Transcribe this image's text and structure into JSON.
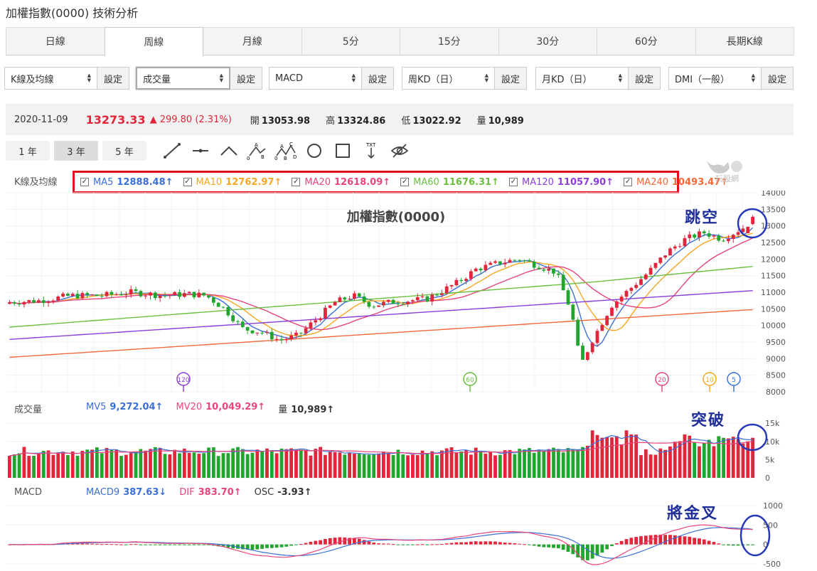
{
  "page_title": "加權指數(0000) 技術分析",
  "tabs": [
    "日線",
    "周線",
    "月線",
    "5分",
    "15分",
    "30分",
    "60分",
    "長期K線"
  ],
  "active_tab": 1,
  "selects": [
    {
      "label": "K線及均線",
      "btn": "設定"
    },
    {
      "label": "成交量",
      "btn": "設定"
    },
    {
      "label": "MACD",
      "btn": "設定"
    },
    {
      "label": "周KD（日）",
      "btn": "設定"
    },
    {
      "label": "月KD（日）",
      "btn": "設定"
    },
    {
      "label": "DMI（一般）",
      "btn": "設定"
    }
  ],
  "quote": {
    "date": "2020-11-09",
    "price": "13273.33",
    "change": "▲ 299.80 (2.31%)",
    "open_label": "開",
    "open": "13053.98",
    "high_label": "高",
    "high": "13324.86",
    "low_label": "低",
    "low": "13022.92",
    "vol_label": "量",
    "vol": "10,989"
  },
  "ranges": [
    "1 年",
    "3 年",
    "5 年"
  ],
  "active_range": 1,
  "tools": [
    "line-tool-icon",
    "horizontal-line-icon",
    "angle-line-icon",
    "abc-pattern-icon",
    "abcd-pattern-icon",
    "circle-tool-icon",
    "rectangle-tool-icon",
    "text-tool-icon",
    "hide-eye-icon"
  ],
  "tool_letters": {
    "a": "A",
    "b": "B",
    "c": "C",
    "d": "D",
    "zero": "0",
    "txt": "TXT"
  },
  "kline_legend": "K線及均線",
  "ma": [
    {
      "name": "MA5",
      "value": "12888.48↑",
      "color": "#3b6fd6"
    },
    {
      "name": "MA10",
      "value": "12762.97↑",
      "color": "#f5a623"
    },
    {
      "name": "MA20",
      "value": "12618.09↑",
      "color": "#e8457a"
    },
    {
      "name": "MA60",
      "value": "11676.31↑",
      "color": "#6abf3f"
    },
    {
      "name": "MA120",
      "value": "11057.90↑",
      "color": "#8a3fd6"
    },
    {
      "name": "MA240",
      "value": "10493.47↑",
      "color": "#f06a3a"
    }
  ],
  "watermark": "玩股網",
  "chart_title": "加權指數(0000)",
  "price_axis": [
    "14000",
    "13500",
    "13000",
    "12500",
    "12000",
    "11500",
    "11000",
    "10500",
    "10000",
    "9500",
    "9000",
    "8500",
    "8000"
  ],
  "ma_markers": [
    {
      "label": "120",
      "color": "#8a3fd6"
    },
    {
      "label": "60",
      "color": "#6abf3f"
    },
    {
      "label": "20",
      "color": "#e8457a"
    },
    {
      "label": "10",
      "color": "#f5a623"
    },
    {
      "label": "5",
      "color": "#3b6fd6"
    }
  ],
  "annotations": {
    "gap": "跳空",
    "breakout": "突破",
    "golden_cross": "將金叉"
  },
  "volume": {
    "label": "成交量",
    "mv5_label": "MV5",
    "mv5": "9,272.04↑",
    "mv20_label": "MV20",
    "mv20": "10,049.29↑",
    "vol_label": "量",
    "vol": "10,989↑",
    "axis": [
      "15k",
      "10k",
      "5k",
      "0"
    ]
  },
  "macd": {
    "label": "MACD",
    "macd9_label": "MACD9",
    "macd9": "387.63↓",
    "dif_label": "DIF",
    "dif": "383.70↑",
    "osc_label": "OSC",
    "osc": "-3.93↑",
    "axis": [
      "1000",
      "500",
      "0",
      "-500"
    ]
  },
  "colors": {
    "up": "#e0263b",
    "down": "#22a52e",
    "annot_blue": "#1f2f9a",
    "highlight_red": "#e0121b"
  }
}
